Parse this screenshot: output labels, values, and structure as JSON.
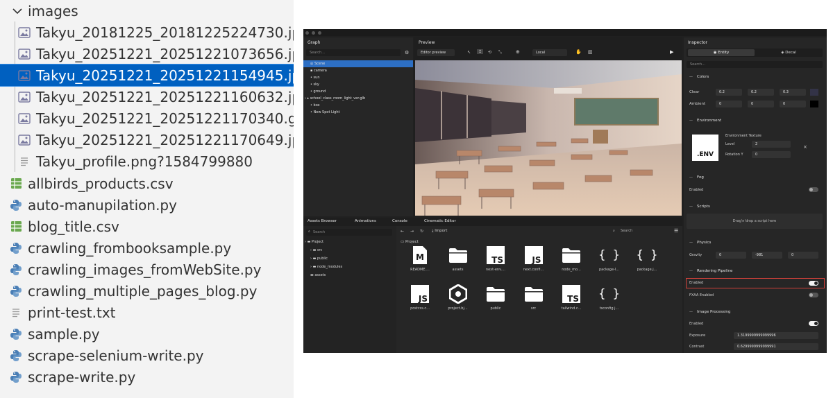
{
  "explorer": {
    "folder_label": "images",
    "items": [
      {
        "label": "Takyu_20181225_20181225224730.jpg",
        "icon": "image-file-icon"
      },
      {
        "label": "Takyu_20251221_20251221073656.jpg",
        "icon": "image-file-icon"
      },
      {
        "label": "Takyu_20251221_20251221154945.jpg",
        "icon": "image-file-icon",
        "selected": true
      },
      {
        "label": "Takyu_20251221_20251221160632.jpg",
        "icon": "image-file-icon"
      },
      {
        "label": "Takyu_20251221_20251221170340.gif",
        "icon": "image-file-icon"
      },
      {
        "label": "Takyu_20251221_20251221170649.jpg",
        "icon": "image-file-icon"
      },
      {
        "label": "Takyu_profile.png?1584799880",
        "icon": "text-file-icon"
      }
    ],
    "root_items": [
      {
        "label": "allbirds_products.csv",
        "icon": "csv-file-icon"
      },
      {
        "label": "auto-manupilation.py",
        "icon": "python-file-icon"
      },
      {
        "label": "blog_title.csv",
        "icon": "csv-file-icon"
      },
      {
        "label": "crawling_frombooksample.py",
        "icon": "python-file-icon"
      },
      {
        "label": "crawling_images_fromWebSite.py",
        "icon": "python-file-icon"
      },
      {
        "label": "crawling_multiple_pages_blog.py",
        "icon": "python-file-icon"
      },
      {
        "label": "print-test.txt",
        "icon": "text-file-icon"
      },
      {
        "label": "sample.py",
        "icon": "python-file-icon"
      },
      {
        "label": "scrape-selenium-write.py",
        "icon": "python-file-icon"
      },
      {
        "label": "scrape-write.py",
        "icon": "python-file-icon"
      }
    ]
  },
  "preview": {
    "graph": {
      "title": "Graph",
      "search_placeholder": "Search...",
      "nodes": [
        "Scene",
        "camera",
        "sun",
        "sky",
        "ground",
        "school_class_room_light_ver.glb",
        "box",
        "New Spot Light"
      ]
    },
    "viewport": {
      "title": "Preview",
      "mode": "Editor preview",
      "space": "Local"
    },
    "inspector": {
      "title": "Inspector",
      "tabs": [
        "Entity",
        "Decal"
      ],
      "search_placeholder": "Search...",
      "colors": {
        "title": "Colors",
        "clear_label": "Clear",
        "clear": [
          "0.2",
          "0.2",
          "0.3"
        ],
        "ambient_label": "Ambient",
        "ambient": [
          "0",
          "0",
          "0"
        ]
      },
      "environment": {
        "title": "Environment",
        "thumb_label": ".ENV",
        "texture_label": "Environment Texture",
        "level_label": "Level",
        "level": "2",
        "rotation_label": "Rotation Y",
        "rotation": "0"
      },
      "fog": {
        "title": "Fog",
        "enabled_label": "Enabled"
      },
      "scripts": {
        "title": "Scripts",
        "drop_hint": "Drag'n'drop a script here"
      },
      "physics": {
        "title": "Physics",
        "gravity_label": "Gravity",
        "gravity": [
          "0",
          "-981",
          "0"
        ]
      },
      "rendering": {
        "title": "Rendering Pipeline",
        "enabled_label": "Enabled",
        "fxaa_label": "FXAA Enabled"
      },
      "image_processing": {
        "title": "Image Processing",
        "enabled_label": "Enabled",
        "exposure_label": "Exposure",
        "exposure": "1.3199999999999996",
        "contrast_label": "Contrast",
        "contrast": "0.6299999999999991"
      }
    },
    "bottom": {
      "tabs": [
        "Assets Browser",
        "Animations",
        "Console",
        "Cinematic Editor"
      ],
      "search_placeholder": "Search",
      "import_label": "Import",
      "tree": [
        "Project",
        "src",
        "public",
        "node_modules",
        "assets"
      ],
      "breadcrumb": "Project",
      "assets": [
        {
          "name": "README....",
          "glyph": "M"
        },
        {
          "name": "assets",
          "glyph": "folder"
        },
        {
          "name": "next-env....",
          "glyph": "TS"
        },
        {
          "name": "next.confi...",
          "glyph": "JS"
        },
        {
          "name": "node_mo...",
          "glyph": "folder"
        },
        {
          "name": "package-l...",
          "glyph": "{ }"
        },
        {
          "name": "package.j...",
          "glyph": "{ }"
        },
        {
          "name": "postcss.c...",
          "glyph": "JS"
        },
        {
          "name": "project.bj...",
          "glyph": "hex"
        },
        {
          "name": "public",
          "glyph": "folder"
        },
        {
          "name": "src",
          "glyph": "folder"
        },
        {
          "name": "tailwind.c...",
          "glyph": "TS"
        },
        {
          "name": "tsconfig.j...",
          "glyph": "{ }"
        }
      ]
    }
  }
}
